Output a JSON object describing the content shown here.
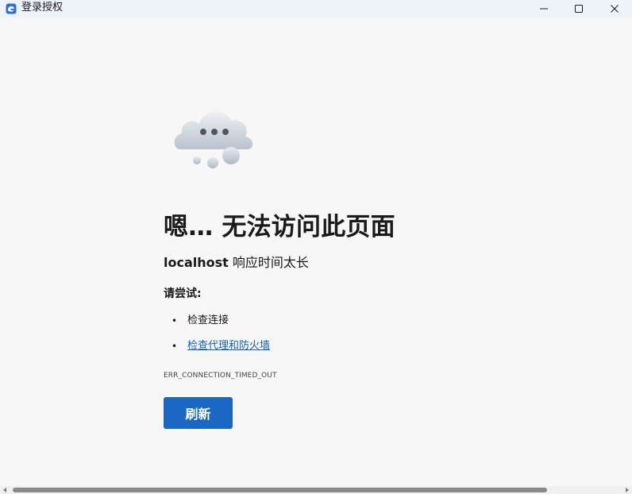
{
  "window": {
    "title": "登录授权",
    "app_icon": "edge-webview-icon",
    "controls": [
      "minimize-icon",
      "maximize-icon",
      "close-icon"
    ]
  },
  "error_page": {
    "illustration": "cloud-thinking-icon",
    "title": "嗯… 无法访问此页面",
    "subtitle_host": "localhost",
    "subtitle_rest": " 响应时间太长",
    "try_heading": "请尝试:",
    "suggestions": [
      {
        "text": "检查连接",
        "is_link": false
      },
      {
        "text": "检查代理和防火墙",
        "is_link": true
      }
    ],
    "error_code": "ERR_CONNECTION_TIMED_OUT",
    "refresh_label": "刷新"
  },
  "colors": {
    "accent": "#1a68c3",
    "link": "#1361b8",
    "background": "#f7f7f7",
    "titlebar": "#eef3f9"
  },
  "scrollbar": {
    "orientation": "horizontal",
    "thumb_fraction": 0.86
  }
}
